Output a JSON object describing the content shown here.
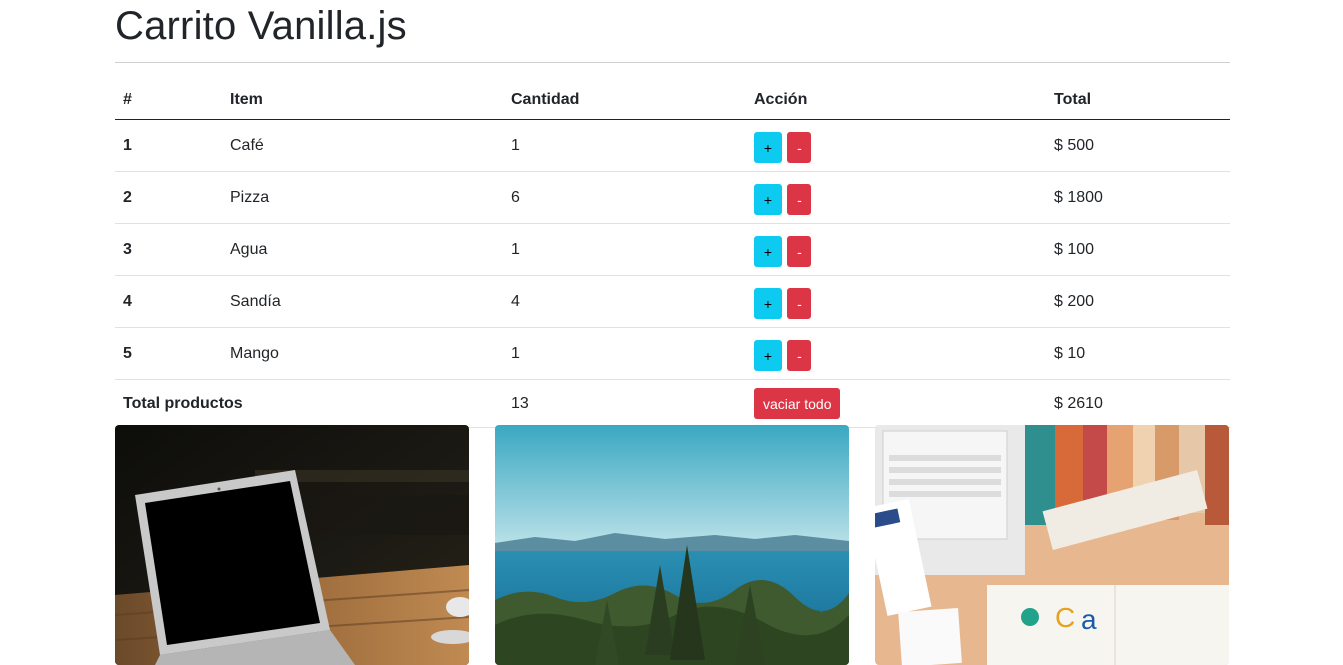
{
  "title": "Carrito Vanilla.js",
  "table": {
    "headers": [
      "#",
      "Item",
      "Cantidad",
      "Acción",
      "Total"
    ],
    "rows": [
      {
        "num": "1",
        "item": "Café",
        "qty": "1",
        "plus": "+",
        "minus": "-",
        "total": "$ 500"
      },
      {
        "num": "2",
        "item": "Pizza",
        "qty": "6",
        "plus": "+",
        "minus": "-",
        "total": "$ 1800"
      },
      {
        "num": "3",
        "item": "Agua",
        "qty": "1",
        "plus": "+",
        "minus": "-",
        "total": "$ 100"
      },
      {
        "num": "4",
        "item": "Sandía",
        "qty": "4",
        "plus": "+",
        "minus": "-",
        "total": "$ 200"
      },
      {
        "num": "5",
        "item": "Mango",
        "qty": "1",
        "plus": "+",
        "minus": "-",
        "total": "$ 10"
      }
    ],
    "footer": {
      "label": "Total productos",
      "qty": "13",
      "clear_label": "vaciar todo",
      "total": "$ 2610"
    }
  },
  "cards": [
    {
      "image": "laptop-on-table-photo"
    },
    {
      "image": "sea-and-forest-photo"
    },
    {
      "image": "desk-with-books-photo"
    }
  ],
  "colors": {
    "info": "#0dcaf0",
    "danger": "#dc3545",
    "text": "#212529"
  }
}
